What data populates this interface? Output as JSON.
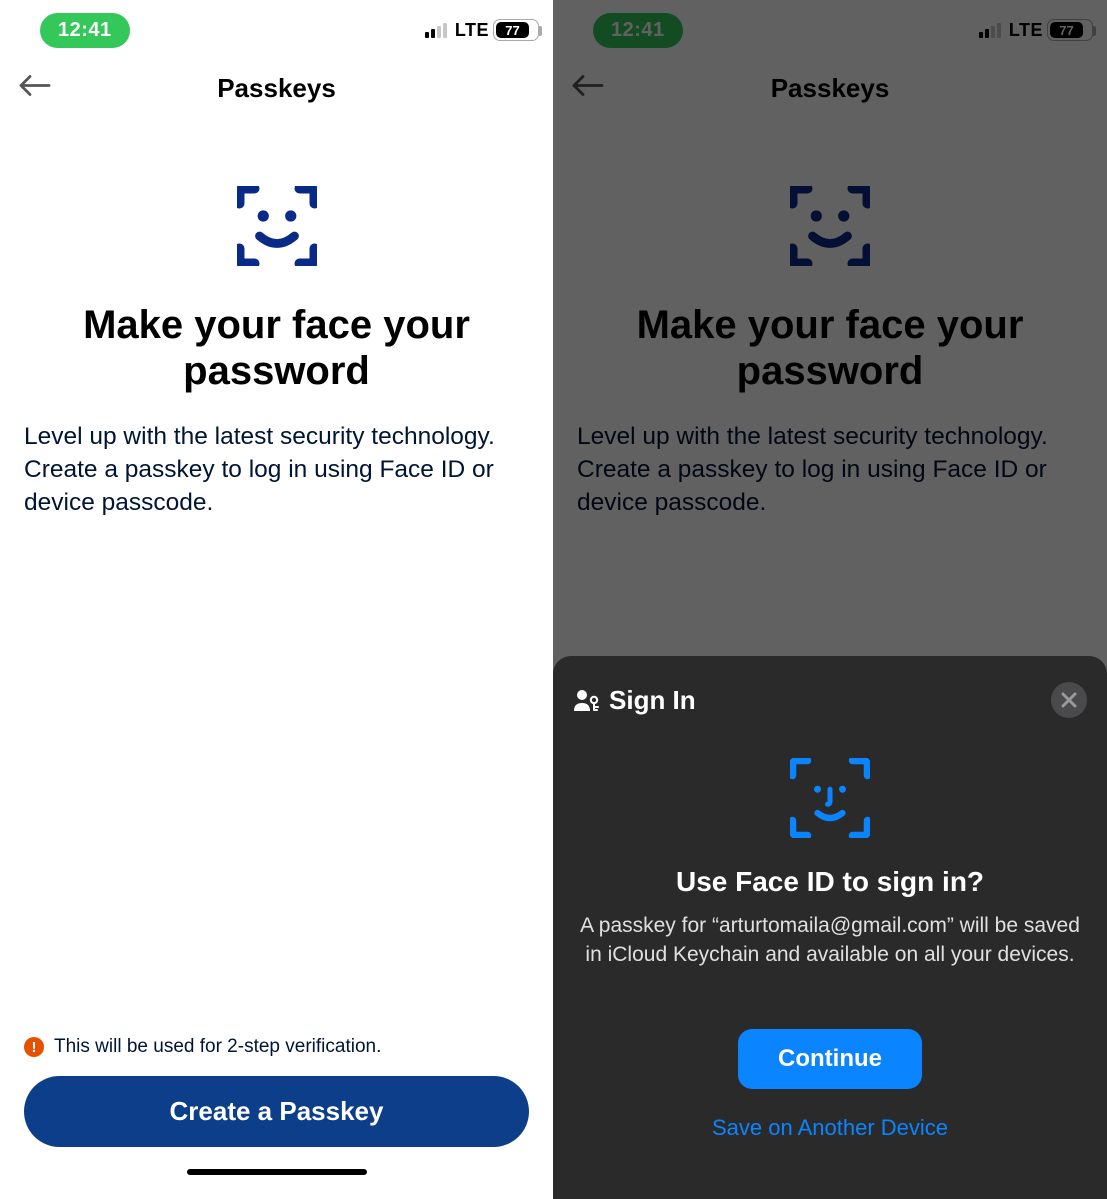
{
  "status": {
    "time": "12:41",
    "network": "LTE",
    "battery": "77"
  },
  "nav": {
    "title": "Passkeys"
  },
  "hero": {
    "title": "Make your face your password",
    "body": "Level up with the latest security technology. Create a passkey to log in using Face ID or device passcode."
  },
  "footer": {
    "info": "This will be used for 2-step verification.",
    "cta": "Create a Passkey"
  },
  "sheet": {
    "header_label": "Sign In",
    "title": "Use Face ID to sign in?",
    "body": "A passkey for “arturtomaila@gmail.com” will be saved in iCloud Keychain and available on all your devices.",
    "continue": "Continue",
    "alt": "Save on Another Device"
  }
}
